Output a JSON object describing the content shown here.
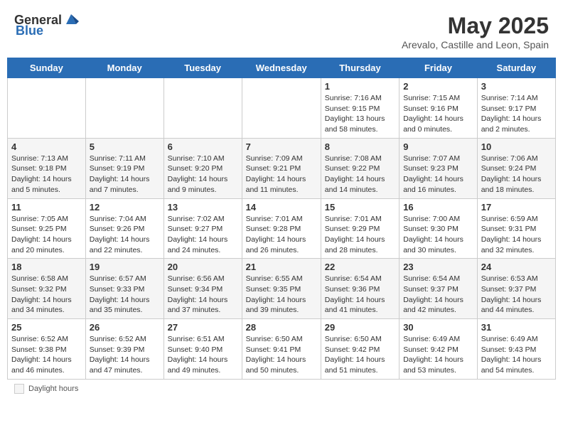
{
  "header": {
    "logo_general": "General",
    "logo_blue": "Blue",
    "month_year": "May 2025",
    "location": "Arevalo, Castille and Leon, Spain"
  },
  "days_of_week": [
    "Sunday",
    "Monday",
    "Tuesday",
    "Wednesday",
    "Thursday",
    "Friday",
    "Saturday"
  ],
  "weeks": [
    [
      {
        "day": "",
        "info": ""
      },
      {
        "day": "",
        "info": ""
      },
      {
        "day": "",
        "info": ""
      },
      {
        "day": "",
        "info": ""
      },
      {
        "day": "1",
        "info": "Sunrise: 7:16 AM\nSunset: 9:15 PM\nDaylight: 13 hours and 58 minutes."
      },
      {
        "day": "2",
        "info": "Sunrise: 7:15 AM\nSunset: 9:16 PM\nDaylight: 14 hours and 0 minutes."
      },
      {
        "day": "3",
        "info": "Sunrise: 7:14 AM\nSunset: 9:17 PM\nDaylight: 14 hours and 2 minutes."
      }
    ],
    [
      {
        "day": "4",
        "info": "Sunrise: 7:13 AM\nSunset: 9:18 PM\nDaylight: 14 hours and 5 minutes."
      },
      {
        "day": "5",
        "info": "Sunrise: 7:11 AM\nSunset: 9:19 PM\nDaylight: 14 hours and 7 minutes."
      },
      {
        "day": "6",
        "info": "Sunrise: 7:10 AM\nSunset: 9:20 PM\nDaylight: 14 hours and 9 minutes."
      },
      {
        "day": "7",
        "info": "Sunrise: 7:09 AM\nSunset: 9:21 PM\nDaylight: 14 hours and 11 minutes."
      },
      {
        "day": "8",
        "info": "Sunrise: 7:08 AM\nSunset: 9:22 PM\nDaylight: 14 hours and 14 minutes."
      },
      {
        "day": "9",
        "info": "Sunrise: 7:07 AM\nSunset: 9:23 PM\nDaylight: 14 hours and 16 minutes."
      },
      {
        "day": "10",
        "info": "Sunrise: 7:06 AM\nSunset: 9:24 PM\nDaylight: 14 hours and 18 minutes."
      }
    ],
    [
      {
        "day": "11",
        "info": "Sunrise: 7:05 AM\nSunset: 9:25 PM\nDaylight: 14 hours and 20 minutes."
      },
      {
        "day": "12",
        "info": "Sunrise: 7:04 AM\nSunset: 9:26 PM\nDaylight: 14 hours and 22 minutes."
      },
      {
        "day": "13",
        "info": "Sunrise: 7:02 AM\nSunset: 9:27 PM\nDaylight: 14 hours and 24 minutes."
      },
      {
        "day": "14",
        "info": "Sunrise: 7:01 AM\nSunset: 9:28 PM\nDaylight: 14 hours and 26 minutes."
      },
      {
        "day": "15",
        "info": "Sunrise: 7:01 AM\nSunset: 9:29 PM\nDaylight: 14 hours and 28 minutes."
      },
      {
        "day": "16",
        "info": "Sunrise: 7:00 AM\nSunset: 9:30 PM\nDaylight: 14 hours and 30 minutes."
      },
      {
        "day": "17",
        "info": "Sunrise: 6:59 AM\nSunset: 9:31 PM\nDaylight: 14 hours and 32 minutes."
      }
    ],
    [
      {
        "day": "18",
        "info": "Sunrise: 6:58 AM\nSunset: 9:32 PM\nDaylight: 14 hours and 34 minutes."
      },
      {
        "day": "19",
        "info": "Sunrise: 6:57 AM\nSunset: 9:33 PM\nDaylight: 14 hours and 35 minutes."
      },
      {
        "day": "20",
        "info": "Sunrise: 6:56 AM\nSunset: 9:34 PM\nDaylight: 14 hours and 37 minutes."
      },
      {
        "day": "21",
        "info": "Sunrise: 6:55 AM\nSunset: 9:35 PM\nDaylight: 14 hours and 39 minutes."
      },
      {
        "day": "22",
        "info": "Sunrise: 6:54 AM\nSunset: 9:36 PM\nDaylight: 14 hours and 41 minutes."
      },
      {
        "day": "23",
        "info": "Sunrise: 6:54 AM\nSunset: 9:37 PM\nDaylight: 14 hours and 42 minutes."
      },
      {
        "day": "24",
        "info": "Sunrise: 6:53 AM\nSunset: 9:37 PM\nDaylight: 14 hours and 44 minutes."
      }
    ],
    [
      {
        "day": "25",
        "info": "Sunrise: 6:52 AM\nSunset: 9:38 PM\nDaylight: 14 hours and 46 minutes."
      },
      {
        "day": "26",
        "info": "Sunrise: 6:52 AM\nSunset: 9:39 PM\nDaylight: 14 hours and 47 minutes."
      },
      {
        "day": "27",
        "info": "Sunrise: 6:51 AM\nSunset: 9:40 PM\nDaylight: 14 hours and 49 minutes."
      },
      {
        "day": "28",
        "info": "Sunrise: 6:50 AM\nSunset: 9:41 PM\nDaylight: 14 hours and 50 minutes."
      },
      {
        "day": "29",
        "info": "Sunrise: 6:50 AM\nSunset: 9:42 PM\nDaylight: 14 hours and 51 minutes."
      },
      {
        "day": "30",
        "info": "Sunrise: 6:49 AM\nSunset: 9:42 PM\nDaylight: 14 hours and 53 minutes."
      },
      {
        "day": "31",
        "info": "Sunrise: 6:49 AM\nSunset: 9:43 PM\nDaylight: 14 hours and 54 minutes."
      }
    ]
  ],
  "footer": {
    "daylight_label": "Daylight hours"
  }
}
